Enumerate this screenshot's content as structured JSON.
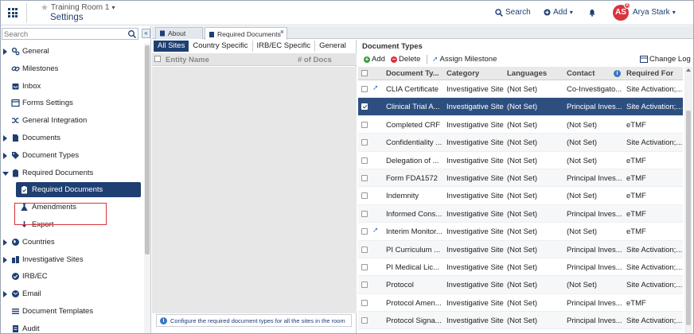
{
  "header": {
    "room_name": "Training Room 1",
    "page_title": "Settings",
    "search_label": "Search",
    "add_label": "Add",
    "user_initials": "AS",
    "user_badge": "A",
    "user_name": "Arya Stark"
  },
  "sidebar": {
    "search_placeholder": "Search",
    "collapse_glyph": "«",
    "items": [
      {
        "label": "General",
        "icon": "gears-icon"
      },
      {
        "label": "Milestones",
        "icon": "link-icon"
      },
      {
        "label": "Inbox",
        "icon": "inbox-icon"
      },
      {
        "label": "Forms Settings",
        "icon": "form-icon"
      },
      {
        "label": "General Integration",
        "icon": "shuffle-icon"
      },
      {
        "label": "Documents",
        "icon": "document-icon"
      },
      {
        "label": "Document Types",
        "icon": "tag-icon"
      },
      {
        "label": "Required Documents",
        "icon": "clipboard-icon"
      },
      {
        "label": "Required Documents",
        "icon": "clipboard-icon"
      },
      {
        "label": "Amendments",
        "icon": "flask-icon"
      },
      {
        "label": "Export",
        "icon": "download-icon"
      },
      {
        "label": "Countries",
        "icon": "globe-icon"
      },
      {
        "label": "Investigative Sites",
        "icon": "sites-icon"
      },
      {
        "label": "IRB/EC",
        "icon": "check-circle-icon"
      },
      {
        "label": "Email",
        "icon": "email-icon"
      },
      {
        "label": "Document Templates",
        "icon": "list-icon"
      },
      {
        "label": "Audit",
        "icon": "audit-icon"
      }
    ]
  },
  "tabs": {
    "about": "About",
    "required_documents": "Required Documents",
    "close_glyph": "×"
  },
  "middle": {
    "subtabs": [
      "All Sites",
      "Country Specific",
      "IRB/EC Specific",
      "General"
    ],
    "col_entity": "Entity Name",
    "col_docs": "# of Docs",
    "info_text": "Configure the required document types for all the sites in the room"
  },
  "right": {
    "title": "Document Types",
    "toolbar": {
      "add": "Add",
      "delete": "Delete",
      "assign_milestone": "Assign Milestone",
      "change_log": "Change Log"
    },
    "columns": [
      "Document Ty...",
      "Category",
      "Languages",
      "Contact",
      "Required For"
    ],
    "rows": [
      {
        "name": "CLIA Certificate",
        "category": "Investigative Site",
        "lang": "(Not Set)",
        "contact": "Co-Investigato...",
        "req": "Site Activation;...",
        "pinned": true,
        "selected": false
      },
      {
        "name": "Clinical Trial A...",
        "category": "Investigative Site",
        "lang": "(Not Set)",
        "contact": "Principal Inves...",
        "req": "Site Activation;...",
        "pinned": false,
        "selected": true
      },
      {
        "name": "Completed CRF",
        "category": "Investigative Site",
        "lang": "(Not Set)",
        "contact": "(Not Set)",
        "req": "eTMF",
        "pinned": false,
        "selected": false
      },
      {
        "name": "Confidentiality ...",
        "category": "Investigative Site",
        "lang": "(Not Set)",
        "contact": "(Not Set)",
        "req": "Site Activation;...",
        "pinned": false,
        "selected": false
      },
      {
        "name": "Delegation of ...",
        "category": "Investigative Site",
        "lang": "(Not Set)",
        "contact": "(Not Set)",
        "req": "eTMF",
        "pinned": false,
        "selected": false
      },
      {
        "name": "Form FDA1572",
        "category": "Investigative Site",
        "lang": "(Not Set)",
        "contact": "Principal Inves...",
        "req": "eTMF",
        "pinned": false,
        "selected": false
      },
      {
        "name": "Indemnity",
        "category": "Investigative Site",
        "lang": "(Not Set)",
        "contact": "(Not Set)",
        "req": "eTMF",
        "pinned": false,
        "selected": false
      },
      {
        "name": "Informed Cons...",
        "category": "Investigative Site",
        "lang": "(Not Set)",
        "contact": "Principal Inves...",
        "req": "eTMF",
        "pinned": false,
        "selected": false
      },
      {
        "name": "Interim Monitor...",
        "category": "Investigative Site",
        "lang": "(Not Set)",
        "contact": "(Not Set)",
        "req": "eTMF",
        "pinned": true,
        "selected": false
      },
      {
        "name": "PI Curriculum ...",
        "category": "Investigative Site",
        "lang": "(Not Set)",
        "contact": "Principal Inves...",
        "req": "Site Activation;...",
        "pinned": false,
        "selected": false
      },
      {
        "name": "PI Medical Lic...",
        "category": "Investigative Site",
        "lang": "(Not Set)",
        "contact": "Principal Inves...",
        "req": "Site Activation;...",
        "pinned": false,
        "selected": false
      },
      {
        "name": "Protocol",
        "category": "Investigative Site",
        "lang": "(Not Set)",
        "contact": "(Not Set)",
        "req": "Site Activation;...",
        "pinned": false,
        "selected": false
      },
      {
        "name": "Protocol Amen...",
        "category": "Investigative Site",
        "lang": "(Not Set)",
        "contact": "Principal Inves...",
        "req": "eTMF",
        "pinned": false,
        "selected": false
      },
      {
        "name": "Protocol Signa...",
        "category": "Investigative Site",
        "lang": "(Not Set)",
        "contact": "Principal Inves...",
        "req": "Site Activation;...",
        "pinned": false,
        "selected": false
      }
    ]
  },
  "colors": {
    "brand_navy": "#1f3f72",
    "selected_row": "#2d4f80",
    "avatar_red": "#d8343e",
    "add_green": "#3a9a3a",
    "delete_red": "#d8343e"
  }
}
